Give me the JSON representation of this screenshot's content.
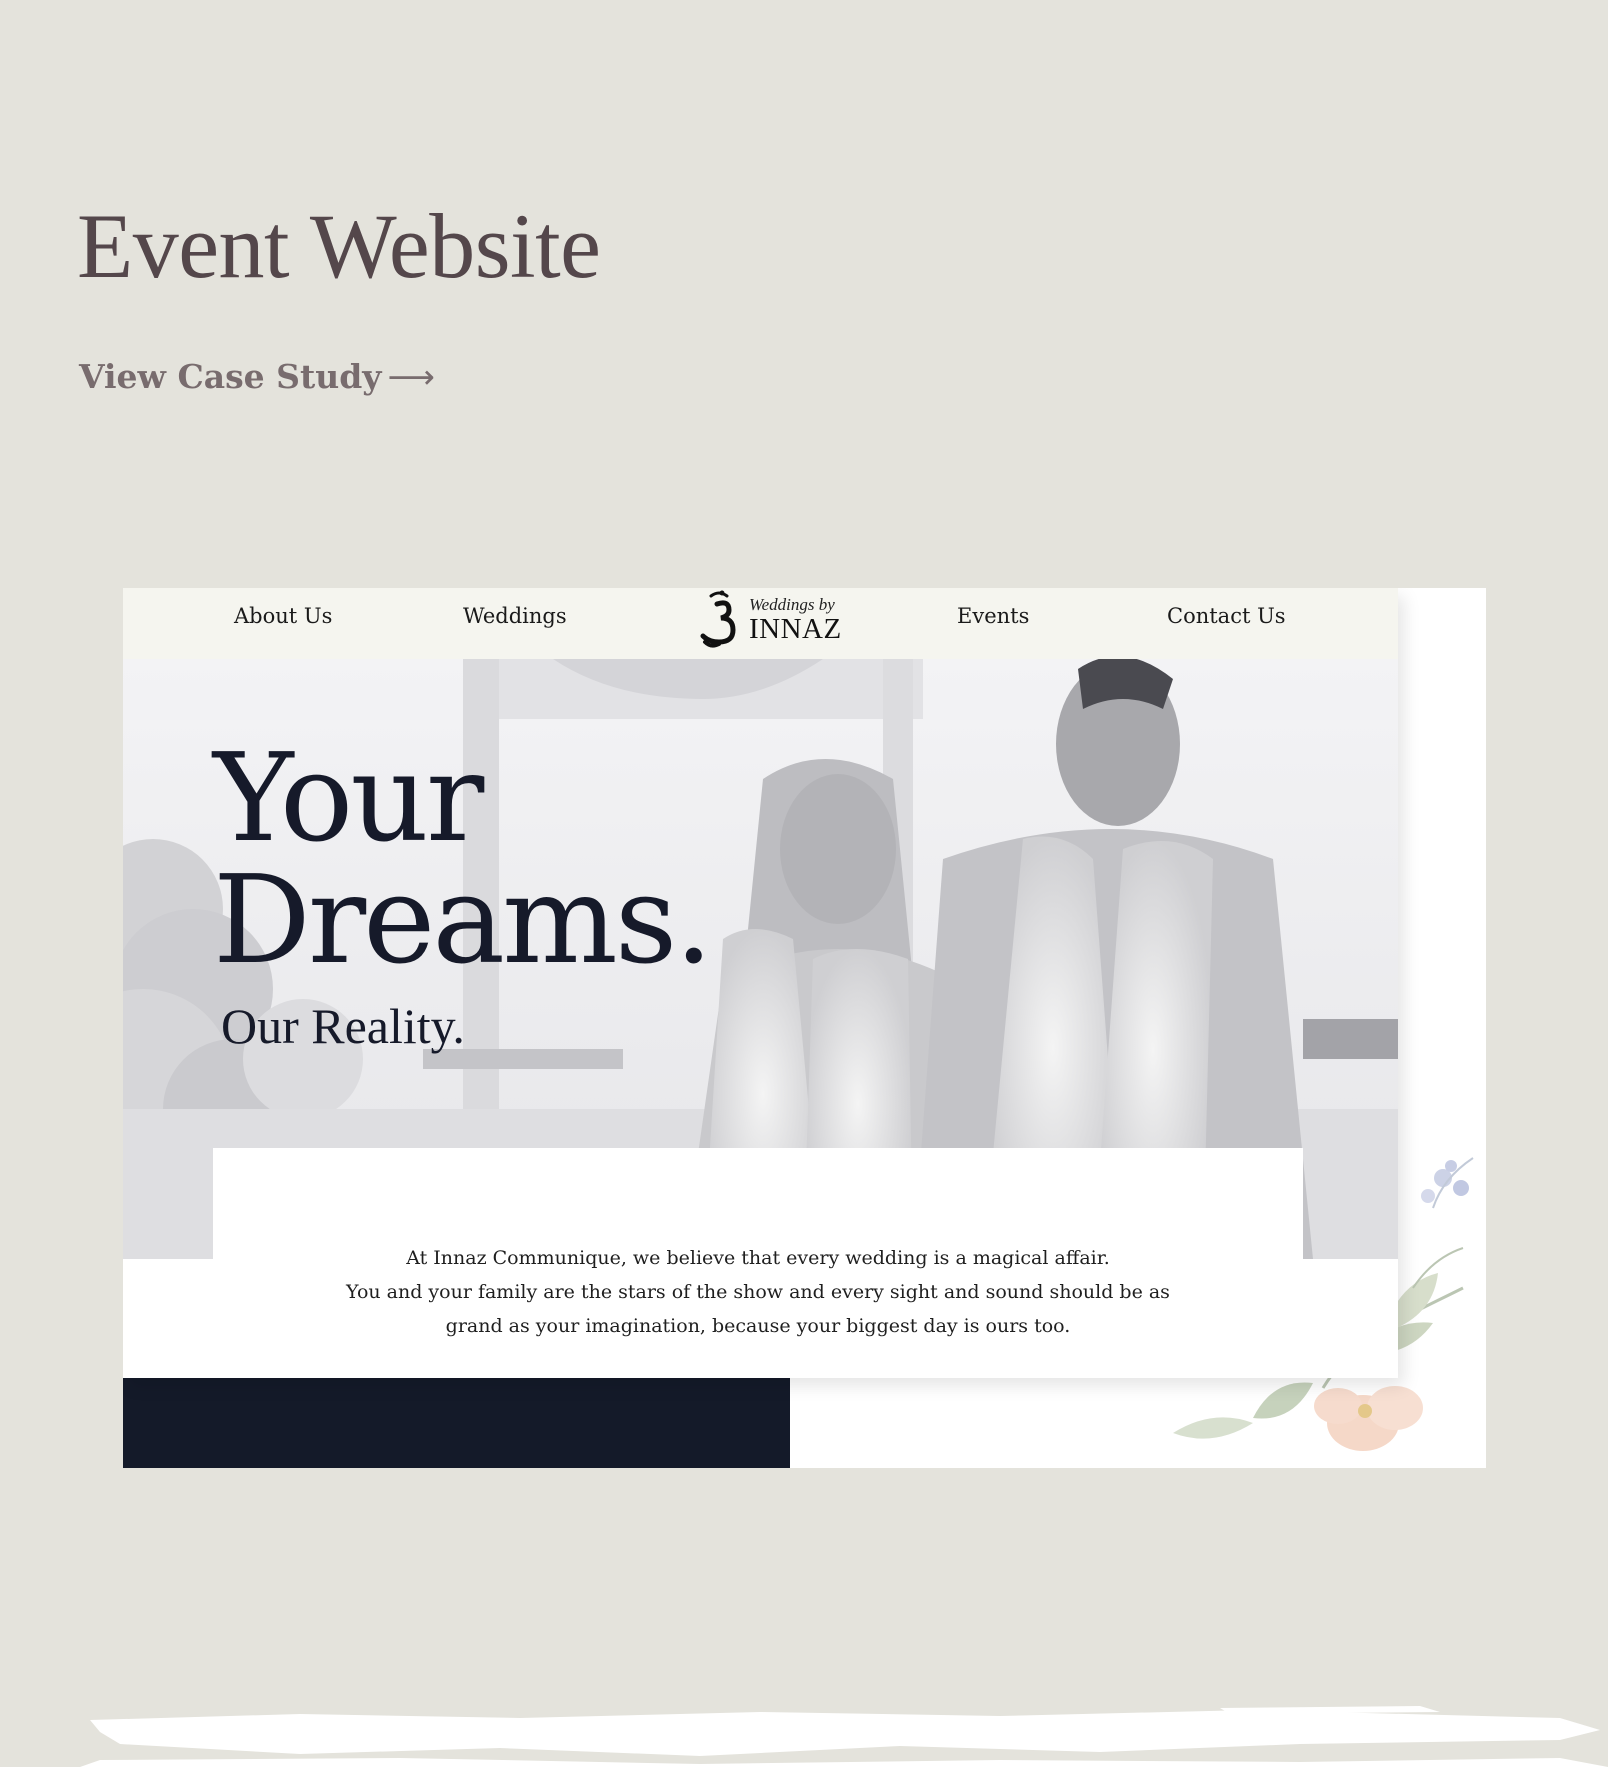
{
  "header": {
    "title": "Event Website",
    "case_study_label": "View Case Study",
    "case_study_arrow": "⟶"
  },
  "mockup": {
    "nav": {
      "items": [
        "About Us",
        "Weddings",
        "Events",
        "Contact Us"
      ],
      "logo_tagline": "Weddings by",
      "logo_brand": "INNAZ"
    },
    "hero": {
      "headline_line1": "Your",
      "headline_line2": "Dreams.",
      "subline": "Our Reality."
    },
    "intro": {
      "line1": "At Innaz Communique, we believe that every wedding is a magical affair.",
      "line2": "You and your family are the stars of the show and every sight and sound should be as",
      "line3": "grand as your imagination, because your biggest day is ours too."
    }
  },
  "colors": {
    "background": "#e4e3dc",
    "title": "#54474b",
    "link": "#786c6e",
    "nav_bg": "#f5f5ef",
    "headline": "#161a2a",
    "dark_bar": "#141a29"
  },
  "icons": {
    "arrow": "long-right-arrow-icon",
    "logo_symbol": "om-symbol-icon"
  }
}
